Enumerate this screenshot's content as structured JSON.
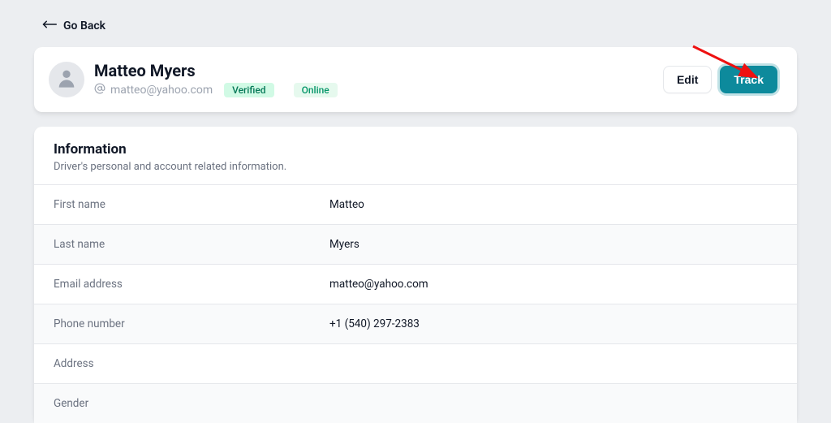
{
  "nav": {
    "go_back": "Go Back"
  },
  "header": {
    "name": "Matteo Myers",
    "email": "matteo@yahoo.com",
    "verified_badge": "Verified",
    "online_badge": "Online",
    "edit_button": "Edit",
    "track_button": "Track"
  },
  "info": {
    "title": "Information",
    "description": "Driver's personal and account related information.",
    "rows": [
      {
        "label": "First name",
        "value": "Matteo"
      },
      {
        "label": "Last name",
        "value": "Myers"
      },
      {
        "label": "Email address",
        "value": "matteo@yahoo.com"
      },
      {
        "label": "Phone number",
        "value": "+1 (540) 297-2383"
      },
      {
        "label": "Address",
        "value": ""
      },
      {
        "label": "Gender",
        "value": ""
      }
    ]
  }
}
